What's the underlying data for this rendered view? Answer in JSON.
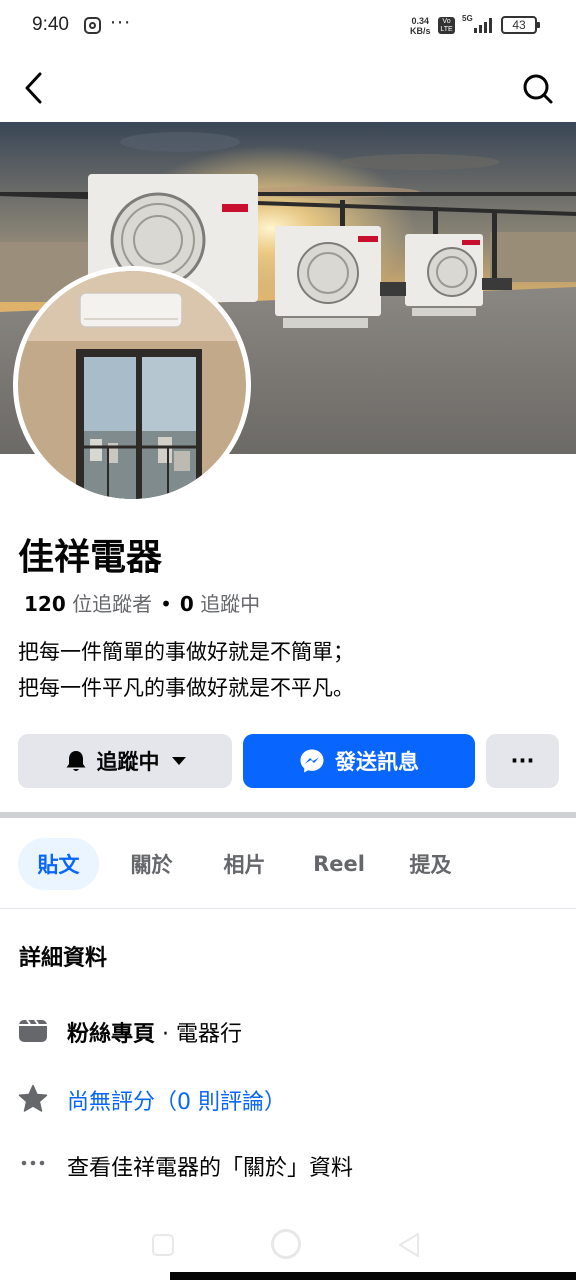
{
  "status_bar": {
    "time": "9:40",
    "more": "···",
    "net_speed_value": "0.34",
    "net_speed_unit": "KB/s",
    "volte_top": "Vo",
    "volte_bottom": "LTE",
    "network": "5G",
    "battery": "43"
  },
  "top_nav": {
    "back_icon": "chevron-left-icon",
    "search_icon": "search-icon"
  },
  "page": {
    "name": "佳祥電器",
    "followers_count": "120",
    "followers_label": "位追蹤者",
    "separator": "•",
    "following_count": "0",
    "following_label": "追蹤中",
    "bio_line1": "把每一件簡單的事做好就是不簡單；",
    "bio_line2": "把每一件平凡的事做好就是不平凡。",
    "cover_brand": "HITACHI"
  },
  "actions": {
    "following_label": "追蹤中",
    "message_label": "發送訊息",
    "more_label": "···"
  },
  "tabs": [
    {
      "label": "貼文",
      "active": true
    },
    {
      "label": "關於",
      "active": false
    },
    {
      "label": "相片",
      "active": false
    },
    {
      "label": "Reel",
      "active": false
    },
    {
      "label": "提及",
      "active": false
    }
  ],
  "details": {
    "title": "詳細資料",
    "category_bold": "粉絲專頁",
    "category_rest": " · 電器行",
    "rating": "尚無評分（0 則評論）",
    "about_link": "查看佳祥電器的「關於」資料"
  },
  "colors": {
    "accent": "#0866ff",
    "button_gray": "#e4e6eb",
    "tab_active_bg": "#ebf5ff",
    "text_secondary": "#65676b"
  }
}
